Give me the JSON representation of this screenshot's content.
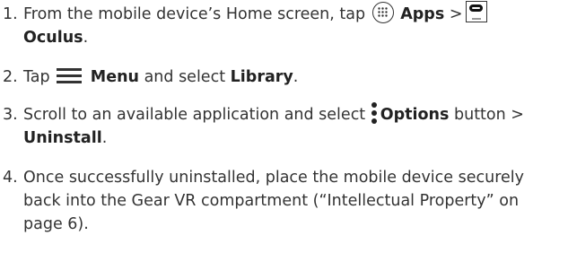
{
  "steps": [
    {
      "number": "1.",
      "text_a": "From the mobile device’s Home screen, tap",
      "apps_icon": "apps-grid-icon",
      "apps_label": "Apps",
      "sep": ">",
      "oculus_icon": "oculus-app-icon",
      "oculus_label": "Oculus",
      "end": "."
    },
    {
      "number": "2.",
      "text_a": "Tap",
      "menu_icon": "hamburger-menu-icon",
      "menu_label": "Menu",
      "text_b": "and select",
      "library_label": "Library",
      "end": "."
    },
    {
      "number": "3.",
      "text_a": "Scroll to an available application and select",
      "options_icon": "more-options-icon",
      "options_label": "Options",
      "text_b": "button >",
      "uninstall_label": "Uninstall",
      "end": "."
    },
    {
      "number": "4.",
      "line1": "Once successfully uninstalled, place the mobile device securely",
      "line2": "back into the Gear VR compartment (“Intellectual Property” on",
      "line3": "page 6)."
    }
  ]
}
